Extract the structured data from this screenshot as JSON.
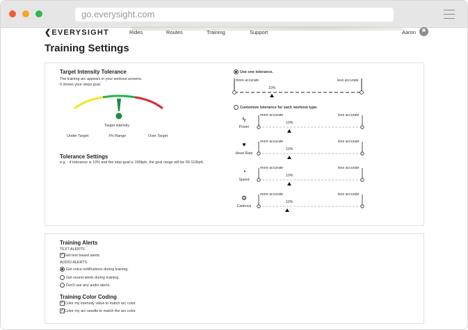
{
  "browser": {
    "url": "go.everysight.com"
  },
  "nav": {
    "logo": "EVERYSIGHT",
    "links": [
      "Rides",
      "Routes",
      "Training",
      "Support"
    ],
    "user": "Aaron"
  },
  "page": {
    "title": "Training Settings"
  },
  "intensity": {
    "heading": "Target Intensity Tolerance",
    "desc1": "The training arc appears in your workout screens.",
    "desc2": "It shows your steps goal.",
    "gauge_target_label": "Target intensity",
    "gauge_range_label": "±% Range",
    "under_label": "Under Target",
    "over_label": "Over Target",
    "colors": {
      "low": "#f2e526",
      "mid": "#23b24a",
      "high": "#d9282f",
      "needle": "#1e8a3c"
    }
  },
  "tolerance": {
    "heading": "Tolerance Settings",
    "example": "e.g. - if tolerance is 10% and the step goal is 100kph, the goal range will be 90-110kph.",
    "option_one": "Use one tolerance.",
    "option_custom": "Customize tolerance for each workout type.",
    "more_accurate": "more accurate",
    "less_accurate": "less accurate",
    "main_value": "10%",
    "metrics": [
      {
        "name": "Power",
        "icon": "lightning-icon",
        "value": "10%"
      },
      {
        "name": "Heart Rate",
        "icon": "heart-rate-icon",
        "value": "10%"
      },
      {
        "name": "Speed",
        "icon": "speedometer-icon",
        "value": "10%"
      },
      {
        "name": "Cadence",
        "icon": "cadence-icon",
        "value": "10%"
      }
    ]
  },
  "alerts": {
    "heading": "Training Alerts",
    "text_heading": "TEXT ALERTS",
    "text_option": "Get text based alerts.",
    "audio_heading": "AUDIO ALERTS",
    "audio_options": [
      "Get voice notifications during training.",
      "Get sound alerts during training.",
      "Don't use any audio alerts."
    ]
  },
  "color_coding": {
    "heading": "Training Color Coding",
    "options": [
      "Color my intensity value to match arc color.",
      "Color my arc needle to match the arc color."
    ]
  }
}
